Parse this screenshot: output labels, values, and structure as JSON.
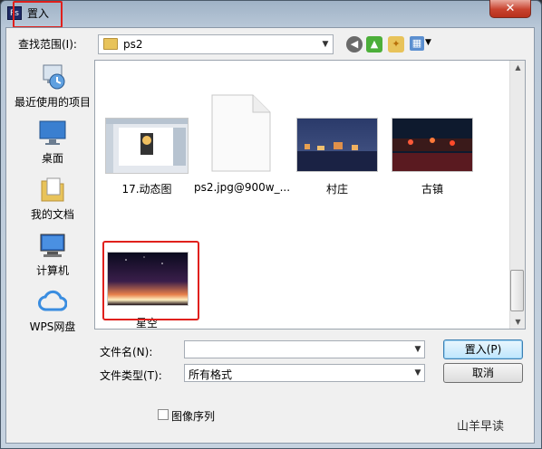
{
  "window": {
    "title": "置入",
    "app_icon": "Ps",
    "close_glyph": "✕"
  },
  "lookin": {
    "label": "查找范围(I):",
    "value": "ps2"
  },
  "places": [
    {
      "label": "最近使用的项目",
      "icon": "recent-icon"
    },
    {
      "label": "桌面",
      "icon": "desktop-icon"
    },
    {
      "label": "我的文档",
      "icon": "documents-icon"
    },
    {
      "label": "计算机",
      "icon": "computer-icon"
    },
    {
      "label": "WPS网盘",
      "icon": "cloud-icon"
    }
  ],
  "files": [
    {
      "name": "17.动态图"
    },
    {
      "name": "ps2.jpg@900w_..."
    },
    {
      "name": "村庄"
    },
    {
      "name": "古镇"
    },
    {
      "name": "星空"
    }
  ],
  "form": {
    "filename_label": "文件名(N):",
    "filename_value": "",
    "filetype_label": "文件类型(T):",
    "filetype_value": "所有格式",
    "place_button": "置入(P)",
    "cancel_button": "取消",
    "image_sequence_label": "图像序列"
  },
  "watermark": "山羊早读",
  "colors": {
    "highlight_red": "#e0201c",
    "accent_blue": "#3c7fb1"
  }
}
